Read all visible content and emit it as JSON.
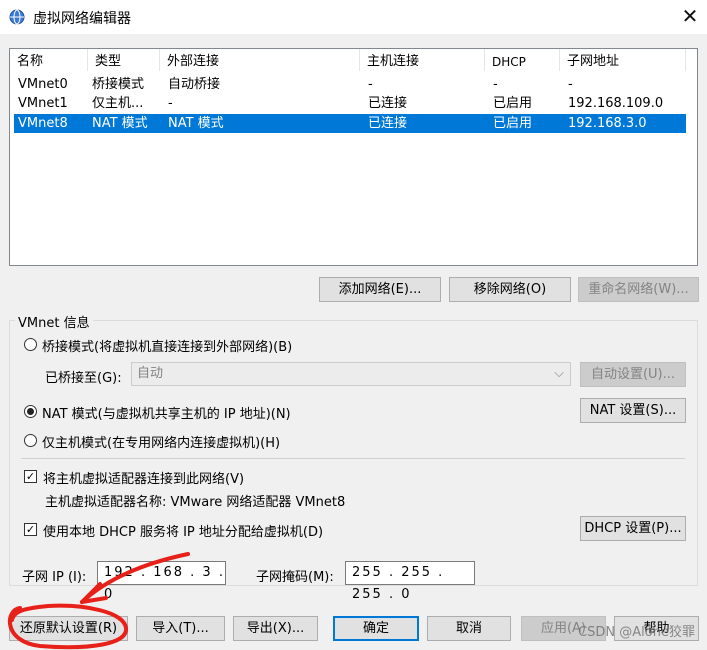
{
  "window": {
    "title": "虚拟网络编辑器",
    "close_symbol": "✕"
  },
  "table": {
    "headers": [
      "名称",
      "类型",
      "外部连接",
      "主机连接",
      "DHCP",
      "子网地址"
    ],
    "rows": [
      [
        "VMnet0",
        "桥接模式",
        "自动桥接",
        "-",
        "-",
        "-"
      ],
      [
        "VMnet1",
        "仅主机...",
        "-",
        "已连接",
        "已启用",
        "192.168.109.0"
      ],
      [
        "VMnet8",
        "NAT 模式",
        "NAT 模式",
        "已连接",
        "已启用",
        "192.168.3.0"
      ]
    ],
    "selected_row": 2
  },
  "buttons": {
    "add_network": "添加网络(E)...",
    "remove_network": "移除网络(O)",
    "rename_network": "重命名网络(W)...",
    "auto_settings": "自动设置(U)...",
    "nat_settings": "NAT 设置(S)...",
    "dhcp_settings": "DHCP 设置(P)...",
    "restore_defaults": "还原默认设置(R)",
    "import": "导入(T)...",
    "export": "导出(X)...",
    "ok": "确定",
    "cancel": "取消",
    "apply": "应用(A)",
    "help": "帮助"
  },
  "vmnet_info": {
    "group_label": "VMnet 信息",
    "bridged_label": "桥接模式(将虚拟机直接连接到外部网络)(B)",
    "bridged_to_label": "已桥接至(G):",
    "bridged_to_value": "自动",
    "nat_label": "NAT 模式(与虚拟机共享主机的 IP 地址)(N)",
    "hostonly_label": "仅主机模式(在专用网络内连接虚拟机)(H)",
    "selected_mode": "nat",
    "connect_adapter_label": "将主机虚拟适配器连接到此网络(V)",
    "connect_adapter_checked": true,
    "adapter_name_label": "主机虚拟适配器名称: VMware 网络适配器 VMnet8",
    "use_dhcp_label": "使用本地 DHCP 服务将 IP 地址分配给虚拟机(D)",
    "use_dhcp_checked": true,
    "subnet_ip_label": "子网 IP (I):",
    "subnet_ip_value": "192 . 168 . 3 . 0",
    "subnet_mask_label": "子网掩码(M):",
    "subnet_mask_value": "255 . 255 . 255 . 0"
  },
  "watermark": "CSDN @Alone狡罪",
  "colors": {
    "selection": "#0078d7",
    "annotation_red": "#e8201a"
  }
}
